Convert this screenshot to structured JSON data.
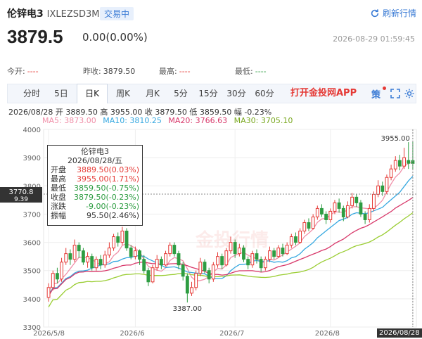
{
  "header": {
    "name": "伦锌电3",
    "code": "IXLEZSD3M",
    "status_badge": "交易中",
    "refresh_label": "刷新行情"
  },
  "quote": {
    "price": "3879.5",
    "change": "0.00(0.00%)",
    "timestamp": "2026-08-29 01:59:45"
  },
  "stats": {
    "open_label": "今开:",
    "open_value": "----",
    "prev_label": "昨收:",
    "prev_value": "3879.50",
    "high_label": "最高:",
    "high_value": "----",
    "low_label": "最低:",
    "low_value": "----"
  },
  "tabs": [
    "分时",
    "5日",
    "日K",
    "周K",
    "月K",
    "5分",
    "15分",
    "30分",
    "60分"
  ],
  "active_tab": "日K",
  "app_link": "打开金投网APP",
  "toolbar": {
    "strategy_label": "策"
  },
  "ohlc_line": "2026/08/28  开 3889.50  高 3955.00  收 3879.50  低 3859.50  幅 -0.23%",
  "ma_labels": {
    "ma5": "MA5: 3873.00",
    "ma10": "MA10: 3810.25",
    "ma20": "MA20: 3766.63",
    "ma30": "MA30: 3705.10"
  },
  "colors": {
    "up": "#e53935",
    "down": "#2e9d42",
    "ma5": "#f08fa8",
    "ma10": "#36a8e0",
    "ma20": "#d8386a",
    "ma30": "#9acd32",
    "accent": "#3a7bd5"
  },
  "tooltip": {
    "title": "伦锌电3",
    "date": "2026/08/28/五",
    "rows": [
      {
        "label": "开盘",
        "value": "3889.50(0.03%)",
        "tone": "red"
      },
      {
        "label": "最高",
        "value": "3955.00(1.71%)",
        "tone": "red"
      },
      {
        "label": "最低",
        "value": "3859.50(-0.75%)",
        "tone": "green"
      },
      {
        "label": "收盘",
        "value": "3879.50(-0.23%)",
        "tone": "green"
      },
      {
        "label": "涨跌",
        "value": "-9.00(-0.23%)",
        "tone": "green"
      },
      {
        "label": "振幅",
        "value": "95.50(2.46%)",
        "tone": "plain"
      }
    ]
  },
  "chart_data": {
    "type": "candlestick",
    "y_ticks": [
      "4000",
      "3900",
      "3800",
      "3700",
      "3600",
      "3500",
      "3400",
      "3300"
    ],
    "ylim": [
      3300,
      4000
    ],
    "crosshair_label": "3770.8",
    "crosshair_value": 3770.8,
    "crosshair_sub": "9.39",
    "max_label": "3955.00",
    "min_label": "3387.00",
    "x_labels": [
      "2026/5/8",
      "2026/6",
      "2026/7",
      "2026/8",
      "2026/08/28"
    ],
    "x_label_index": [
      0,
      20,
      43,
      65,
      84
    ],
    "candles": [
      [
        3405,
        3440,
        3390,
        3455
      ],
      [
        3440,
        3490,
        3430,
        3500
      ],
      [
        3490,
        3470,
        3455,
        3510
      ],
      [
        3470,
        3530,
        3460,
        3545
      ],
      [
        3530,
        3560,
        3520,
        3580
      ],
      [
        3560,
        3540,
        3520,
        3575
      ],
      [
        3540,
        3590,
        3530,
        3610
      ],
      [
        3590,
        3570,
        3545,
        3600
      ],
      [
        3570,
        3530,
        3520,
        3580
      ],
      [
        3530,
        3550,
        3510,
        3565
      ],
      [
        3550,
        3510,
        3500,
        3560
      ],
      [
        3510,
        3540,
        3500,
        3550
      ],
      [
        3540,
        3520,
        3505,
        3555
      ],
      [
        3520,
        3555,
        3510,
        3570
      ],
      [
        3555,
        3580,
        3545,
        3600
      ],
      [
        3580,
        3620,
        3570,
        3630
      ],
      [
        3620,
        3600,
        3585,
        3635
      ],
      [
        3600,
        3640,
        3590,
        3655
      ],
      [
        3640,
        3580,
        3570,
        3650
      ],
      [
        3580,
        3550,
        3540,
        3590
      ],
      [
        3550,
        3570,
        3540,
        3585
      ],
      [
        3570,
        3540,
        3520,
        3575
      ],
      [
        3540,
        3500,
        3490,
        3555
      ],
      [
        3500,
        3460,
        3445,
        3510
      ],
      [
        3460,
        3510,
        3455,
        3520
      ],
      [
        3510,
        3540,
        3500,
        3555
      ],
      [
        3540,
        3520,
        3505,
        3550
      ],
      [
        3520,
        3560,
        3515,
        3570
      ],
      [
        3560,
        3590,
        3550,
        3600
      ],
      [
        3590,
        3560,
        3550,
        3600
      ],
      [
        3560,
        3520,
        3505,
        3570
      ],
      [
        3520,
        3480,
        3465,
        3530
      ],
      [
        3480,
        3420,
        3387,
        3490
      ],
      [
        3420,
        3440,
        3410,
        3460
      ],
      [
        3440,
        3490,
        3430,
        3500
      ],
      [
        3490,
        3530,
        3480,
        3545
      ],
      [
        3530,
        3500,
        3490,
        3540
      ],
      [
        3500,
        3470,
        3455,
        3510
      ],
      [
        3470,
        3520,
        3460,
        3530
      ],
      [
        3520,
        3550,
        3510,
        3565
      ],
      [
        3550,
        3520,
        3505,
        3560
      ],
      [
        3520,
        3570,
        3515,
        3580
      ],
      [
        3570,
        3600,
        3560,
        3620
      ],
      [
        3600,
        3560,
        3545,
        3610
      ],
      [
        3560,
        3580,
        3550,
        3595
      ],
      [
        3580,
        3540,
        3530,
        3590
      ],
      [
        3540,
        3520,
        3505,
        3550
      ],
      [
        3520,
        3560,
        3510,
        3570
      ],
      [
        3560,
        3540,
        3525,
        3575
      ],
      [
        3540,
        3510,
        3495,
        3550
      ],
      [
        3510,
        3540,
        3500,
        3550
      ],
      [
        3540,
        3570,
        3530,
        3585
      ],
      [
        3570,
        3550,
        3540,
        3580
      ],
      [
        3550,
        3580,
        3545,
        3590
      ],
      [
        3580,
        3560,
        3550,
        3595
      ],
      [
        3560,
        3590,
        3555,
        3600
      ],
      [
        3590,
        3620,
        3580,
        3630
      ],
      [
        3620,
        3600,
        3590,
        3635
      ],
      [
        3600,
        3640,
        3595,
        3650
      ],
      [
        3640,
        3670,
        3630,
        3680
      ],
      [
        3670,
        3650,
        3640,
        3685
      ],
      [
        3650,
        3690,
        3645,
        3700
      ],
      [
        3690,
        3720,
        3680,
        3730
      ],
      [
        3720,
        3700,
        3690,
        3735
      ],
      [
        3700,
        3680,
        3665,
        3710
      ],
      [
        3680,
        3710,
        3670,
        3720
      ],
      [
        3710,
        3740,
        3700,
        3750
      ],
      [
        3740,
        3720,
        3705,
        3755
      ],
      [
        3720,
        3690,
        3675,
        3730
      ],
      [
        3690,
        3730,
        3685,
        3745
      ],
      [
        3730,
        3760,
        3720,
        3775
      ],
      [
        3760,
        3740,
        3725,
        3770
      ],
      [
        3740,
        3700,
        3690,
        3750
      ],
      [
        3700,
        3680,
        3665,
        3710
      ],
      [
        3680,
        3720,
        3670,
        3735
      ],
      [
        3720,
        3770,
        3710,
        3780
      ],
      [
        3770,
        3800,
        3760,
        3820
      ],
      [
        3800,
        3780,
        3765,
        3815
      ],
      [
        3780,
        3830,
        3770,
        3840
      ],
      [
        3830,
        3860,
        3820,
        3875
      ],
      [
        3860,
        3890,
        3850,
        3905
      ],
      [
        3890,
        3870,
        3855,
        3910
      ],
      [
        3870,
        3900,
        3860,
        3935
      ],
      [
        3890,
        3880,
        3860,
        3955
      ],
      [
        3889.5,
        3879.5,
        3859.5,
        3955
      ]
    ],
    "ma_series": [
      {
        "name": "MA5",
        "y0": 3420,
        "y1": 3873
      },
      {
        "name": "MA10",
        "y0": 3395,
        "y1": 3810
      },
      {
        "name": "MA20",
        "y0": 3390,
        "y1": 3766
      },
      {
        "name": "MA30",
        "y0": 3325,
        "y1": 3705
      }
    ]
  }
}
